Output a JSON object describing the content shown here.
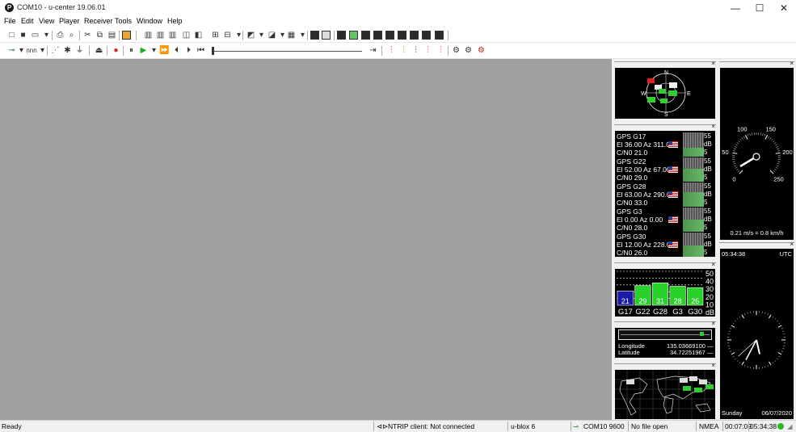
{
  "window": {
    "title": "COM10 - u-center 19.06.01",
    "icon_letter": "P",
    "minimize": "—",
    "maximize": "☐",
    "close": "✕"
  },
  "menu": [
    "File",
    "Edit",
    "View",
    "Player",
    "Receiver",
    "Tools",
    "Window",
    "Help"
  ],
  "toolbar2": {
    "rate_label": "nnn"
  },
  "sky_view": {
    "north": "N",
    "south": "S",
    "east": "E",
    "west": "W"
  },
  "signal_list": [
    {
      "name": "GPS G17",
      "pos": "El 36.00 Az 311.00",
      "cn0": "C/N0 21.0",
      "db_top": "55",
      "db_mid": "dB",
      "db_bot": "5"
    },
    {
      "name": "GPS G22",
      "pos": "El 52.00 Az 67.00",
      "cn0": "C/N0 29.0",
      "db_top": "55",
      "db_mid": "dB",
      "db_bot": "5"
    },
    {
      "name": "GPS G28",
      "pos": "El 63.00 Az 290.00",
      "cn0": "C/N0 33.0",
      "db_top": "55",
      "db_mid": "dB",
      "db_bot": "5"
    },
    {
      "name": "GPS G3",
      "pos": "El 0.00 Az 0.00",
      "cn0": "C/N0 28.0",
      "db_top": "55",
      "db_mid": "dB",
      "db_bot": "5"
    },
    {
      "name": "GPS G30",
      "pos": "El 12.00 Az 228.00",
      "cn0": "C/N0 26.0",
      "db_top": "55",
      "db_mid": "dB",
      "db_bot": "5"
    }
  ],
  "bar_chart": {
    "y_ticks": [
      "50",
      "40",
      "30",
      "20",
      "10",
      "dB"
    ],
    "bars": [
      {
        "label": "G17",
        "value": "21",
        "cn0": 21
      },
      {
        "label": "G22",
        "value": "29",
        "cn0": 29
      },
      {
        "label": "G28",
        "value": "31",
        "cn0": 33
      },
      {
        "label": "G3",
        "value": "28",
        "cn0": 28
      },
      {
        "label": "G30",
        "value": "26",
        "cn0": 26
      }
    ]
  },
  "position": {
    "lon_label": "Longitude",
    "lon_value": "135.03669100 —",
    "lat_label": "Latitude",
    "lat_value": "34.72251967 —"
  },
  "speedometer": {
    "ticks": [
      "0",
      "50",
      "100",
      "150",
      "200",
      "250"
    ],
    "readout": "0.21 m/s = 0.8 km/h"
  },
  "clock": {
    "time": "05:34:38",
    "zone": "UTC",
    "day": "Sunday",
    "date": "06/07/2020"
  },
  "status": {
    "ready": "Ready",
    "ntrip": "NTRIP client: Not connected",
    "receiver": "u-blox 6",
    "port": "COM10 9600",
    "file": "No file open",
    "protocol": "NMEA",
    "elapsed": "00:07:09",
    "time": "05:34:38"
  },
  "colors": {
    "mdi_background": "#a0a0a0",
    "signal_green": "#2bd12b",
    "status_ok": "#2bb82b"
  }
}
